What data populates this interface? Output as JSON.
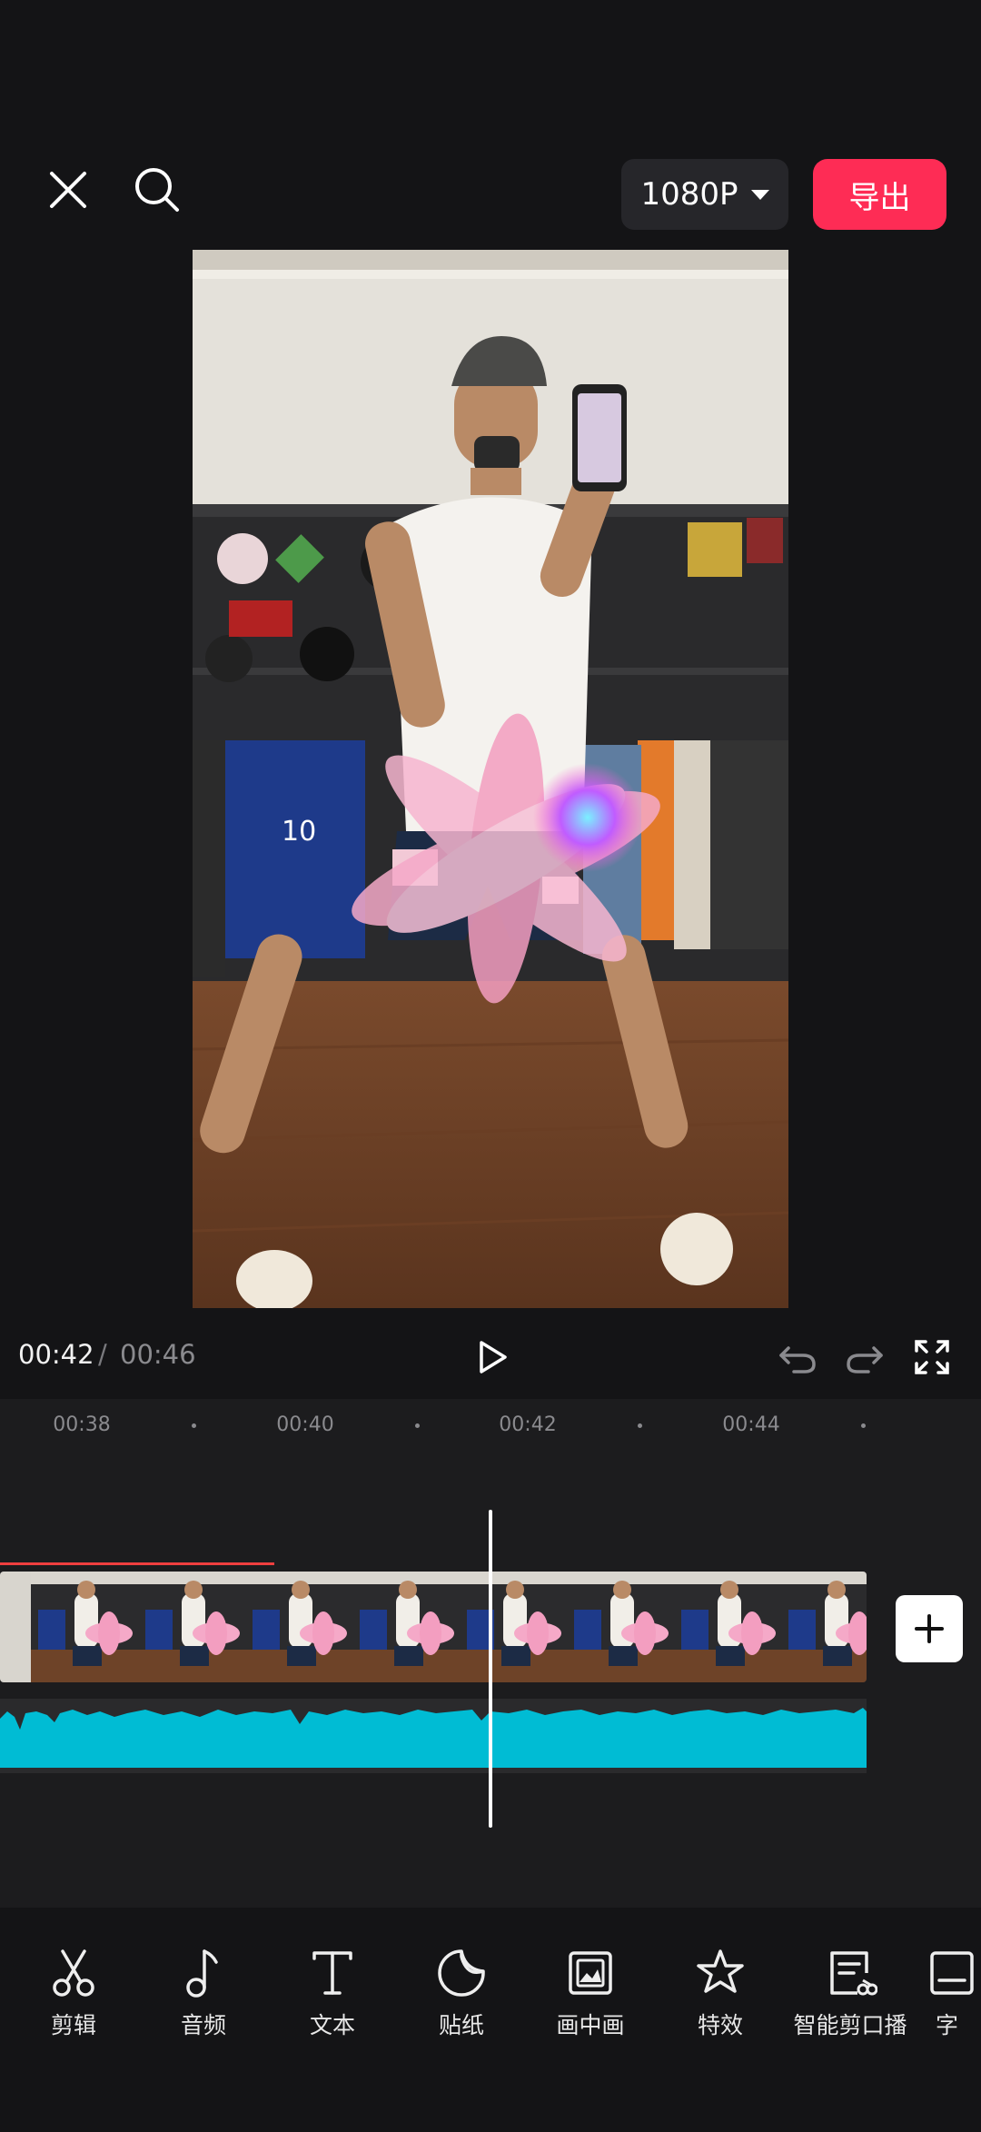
{
  "header": {
    "resolution": "1080P",
    "export_label": "导出"
  },
  "player": {
    "current_time": "00:42",
    "separator": "/",
    "total_time": "00:46"
  },
  "timeline": {
    "ruler_labels": [
      "00:38",
      "00:40",
      "00:42",
      "00:44"
    ],
    "audio_color": "#00bcd4",
    "accent_color": "#fe2c55"
  },
  "toolbar": {
    "items": [
      {
        "label": "剪辑",
        "icon": "scissors-icon"
      },
      {
        "label": "音频",
        "icon": "music-note-icon"
      },
      {
        "label": "文本",
        "icon": "text-icon"
      },
      {
        "label": "贴纸",
        "icon": "sticker-icon"
      },
      {
        "label": "画中画",
        "icon": "picture-in-picture-icon"
      },
      {
        "label": "特效",
        "icon": "effects-star-icon"
      },
      {
        "label": "智能剪口播",
        "icon": "smart-cut-icon"
      },
      {
        "label": "字",
        "icon": "captions-icon"
      }
    ]
  }
}
